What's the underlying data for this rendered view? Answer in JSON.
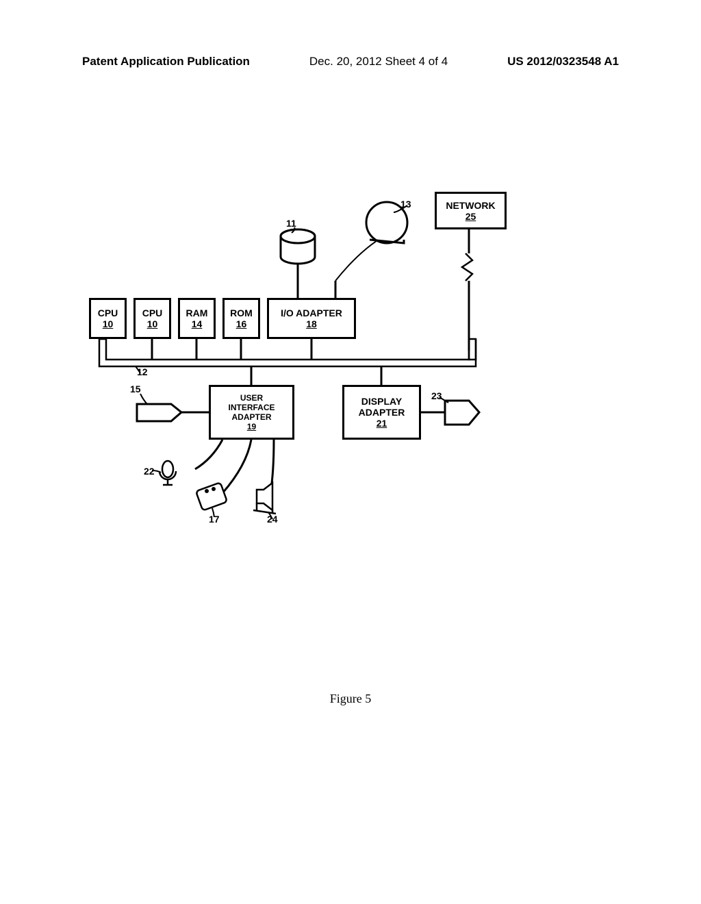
{
  "header": {
    "left": "Patent Application Publication",
    "center": "Dec. 20, 2012  Sheet 4 of 4",
    "right": "US 2012/0323548 A1"
  },
  "blocks": {
    "cpu1": {
      "label": "CPU",
      "number": "10"
    },
    "cpu2": {
      "label": "CPU",
      "number": "10"
    },
    "ram": {
      "label": "RAM",
      "number": "14"
    },
    "rom": {
      "label": "ROM",
      "number": "16"
    },
    "io_adapter": {
      "label": "I/O ADAPTER",
      "number": "18"
    },
    "network": {
      "label": "NETWORK",
      "number": "25"
    },
    "ui_adapter": {
      "line1": "USER",
      "line2": "INTERFACE",
      "line3": "ADAPTER",
      "number": "19"
    },
    "display_adapter": {
      "line1": "DISPLAY",
      "line2": "ADAPTER",
      "number": "21"
    }
  },
  "refs": {
    "r11": "11",
    "r12": "12",
    "r13": "13",
    "r15": "15",
    "r17": "17",
    "r22": "22",
    "r23": "23",
    "r24": "24"
  },
  "figure_label": "Figure 5"
}
